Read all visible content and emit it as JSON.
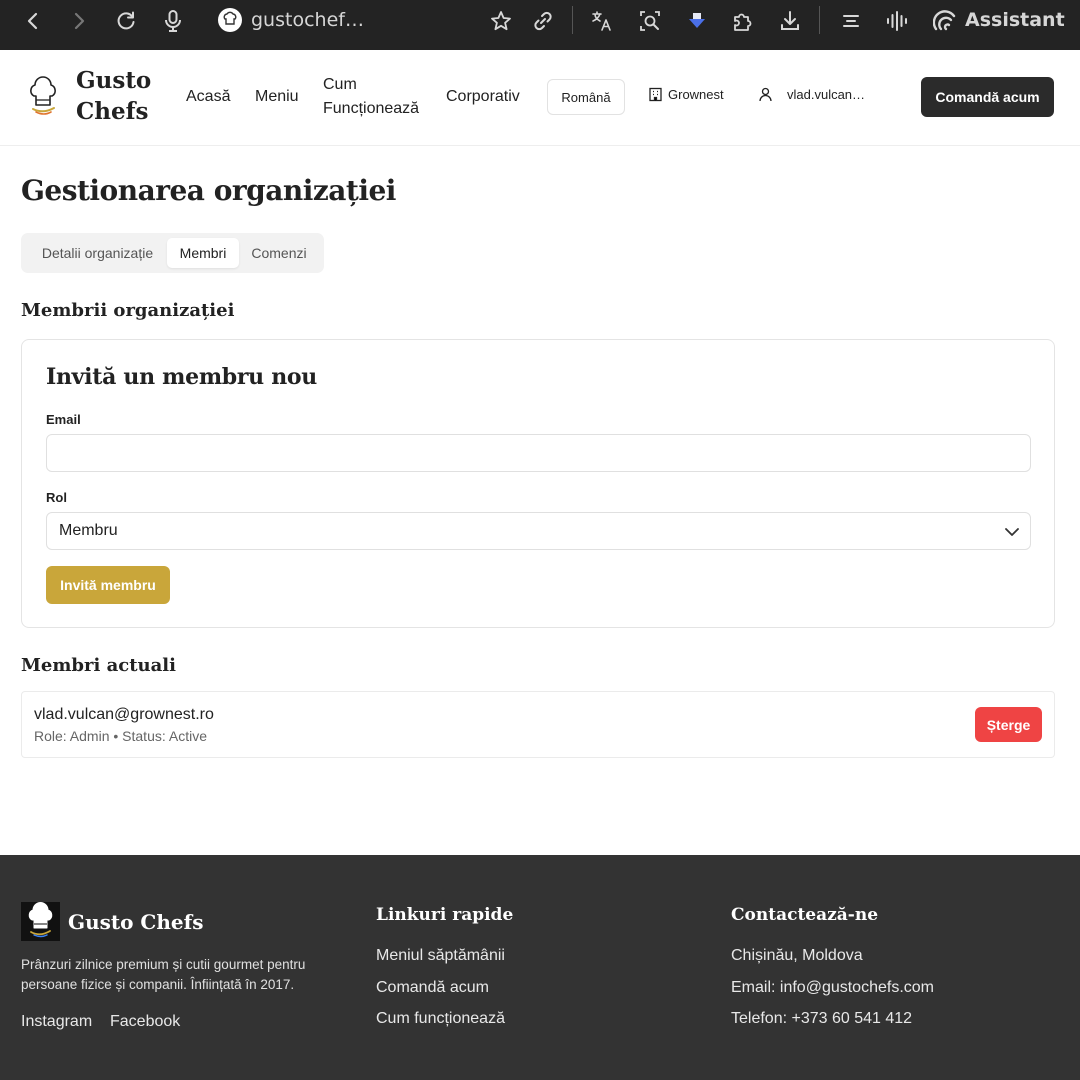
{
  "browser": {
    "url": "gustochef…",
    "assistant_label": "Assistant"
  },
  "header": {
    "brand_line1": "Gusto",
    "brand_line2": "Chefs",
    "nav": {
      "home": "Acasă",
      "menu": "Meniu",
      "how_line1": "Cum",
      "how_line2": "Funcționează",
      "corporate": "Corporativ"
    },
    "language": "Română",
    "organization": "Grownest",
    "user": "vlad.vulcan…",
    "order_button": "Comandă acum"
  },
  "main": {
    "title": "Gestionarea organizației",
    "tabs": [
      {
        "label": "Detalii organizație",
        "active": false
      },
      {
        "label": "Membri",
        "active": true
      },
      {
        "label": "Comenzi",
        "active": false
      }
    ],
    "members_section_title": "Membrii organizației",
    "invite": {
      "title": "Invită un membru nou",
      "email_label": "Email",
      "email_value": "",
      "role_label": "Rol",
      "role_value": "Membru",
      "button": "Invită membru"
    },
    "current_members_title": "Membri actuali",
    "members": [
      {
        "email": "vlad.vulcan@grownest.ro",
        "meta": "Role: Admin • Status: Active",
        "delete_label": "Șterge"
      }
    ]
  },
  "footer": {
    "brand": "Gusto Chefs",
    "description": "Prânzuri zilnice premium și cutii gourmet pentru persoane fizice și companii. Înființată în 2017.",
    "social": [
      "Instagram",
      "Facebook"
    ],
    "quick_links_title": "Linkuri rapide",
    "quick_links": [
      "Meniul săptămânii",
      "Comandă acum",
      "Cum funcționează"
    ],
    "contact_title": "Contactează-ne",
    "contact": [
      "Chișinău, Moldova",
      "Email: info@gustochefs.com",
      "Telefon: +373 60 541 412"
    ]
  },
  "colors": {
    "accent_gold": "#c9a63a",
    "danger": "#ef4444",
    "dark_button": "#2b2b2b",
    "footer_bg": "#333333",
    "browser_bar": "#232323"
  },
  "icons": [
    "back-icon",
    "forward-icon",
    "reload-icon",
    "mic-icon",
    "bookmark-star-icon",
    "link-icon",
    "translate-icon",
    "lens-search-icon",
    "extension-arrow-icon",
    "puzzle-icon",
    "download-icon",
    "reader-icon",
    "voice-wave-icon",
    "assistant-icon",
    "chef-hat-logo-icon",
    "building-icon",
    "user-icon",
    "chevron-down-icon"
  ]
}
